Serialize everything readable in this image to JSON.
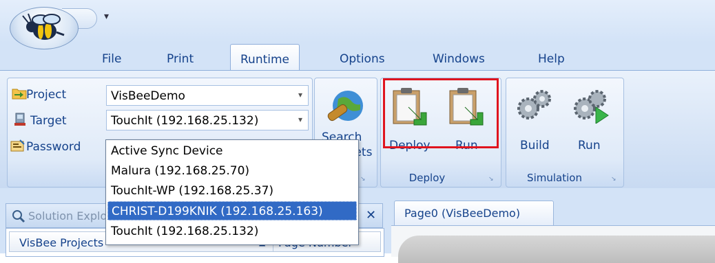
{
  "app": {
    "qat_dropdown_glyph": "▾"
  },
  "menu": {
    "tabs": [
      "File",
      "Print",
      "Runtime",
      "Options",
      "Windows",
      "Help"
    ],
    "active_tab": "Runtime"
  },
  "ribbon": {
    "project_label": "Project",
    "project_value": "VisBeeDemo",
    "target_label": "Target",
    "target_value": "TouchIt (192.168.25.132)",
    "password_label": "Password",
    "search_label_line1": "Search",
    "search_label_line2": "Targets",
    "deploy_button": "Deploy",
    "run_button": "Run",
    "deploy_group": "Deploy",
    "build_button": "Build",
    "sim_run_button": "Run",
    "simulation_group": "Simulation",
    "launcher_glyph": "↘",
    "arrow_glyph": "▾"
  },
  "target_dropdown": {
    "options": [
      "Active Sync Device",
      "Malura (192.168.25.70)",
      "TouchIt-WP (192.168.25.37)",
      "CHRIST-D199KNIK (192.168.25.163)",
      "TouchIt (192.168.25.132)"
    ],
    "selected_index": 3
  },
  "solution_explorer": {
    "title": "Solution Explorer",
    "close_glyph": "✕",
    "col_projects": "VisBee Projects",
    "sort_glyph": "▲",
    "col_page_number": "Page Number"
  },
  "document": {
    "tab_label": "Page0 (VisBeeDemo)"
  },
  "colors": {
    "highlight": "#e0141e",
    "selection": "#316ac5",
    "ribbon_text": "#15428b"
  }
}
